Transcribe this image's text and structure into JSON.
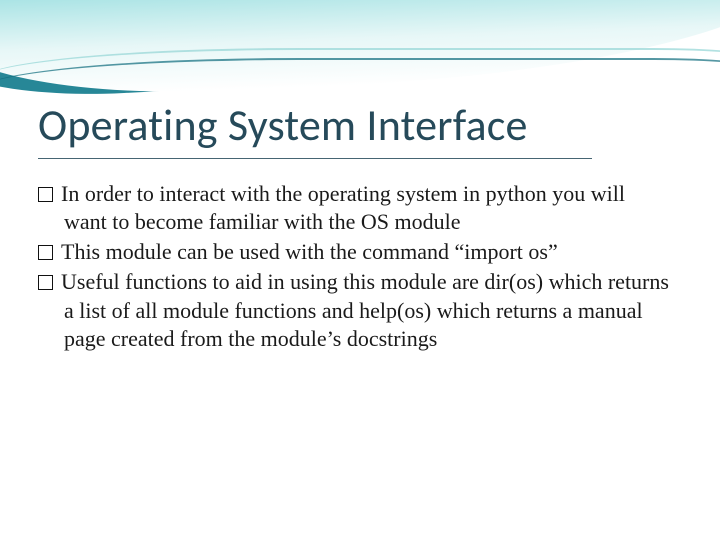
{
  "title": "Operating System Interface",
  "bullets": [
    "In order to interact with the operating system in python you will want to become familiar with the OS module",
    "This module can be used with the command “import os”",
    "Useful functions to aid in using this module are dir(os) which returns a list of all module functions and help(os) which returns a manual page created from the module’s docstrings"
  ],
  "colors": {
    "title": "#264a5a",
    "accent_dark": "#0f7a8c",
    "accent_light": "#7fd6d8"
  }
}
